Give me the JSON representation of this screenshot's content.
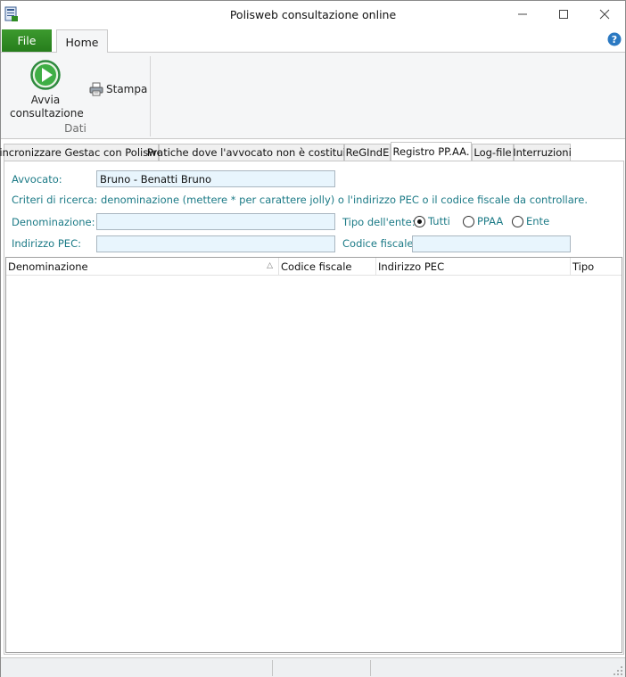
{
  "window": {
    "title": "Polisweb consultazione online"
  },
  "ribbon": {
    "tabs": [
      "File",
      "Home"
    ],
    "active_tab": "Home",
    "buttons": {
      "avvia_line1": "Avvia",
      "avvia_line2": "consultazione",
      "stampa": "Stampa"
    },
    "group_label": "Dati"
  },
  "content_tabs": [
    "Sincronizzare Gestac con Polisweb",
    "Pratiche dove l'avvocato non è costituito",
    "ReGIndE",
    "Registro PP.AA.",
    "Log-file",
    "Interruzioni"
  ],
  "active_content_tab": "Registro PP.AA.",
  "form": {
    "avvocato_label": "Avvocato:",
    "avvocato_value": "Bruno - Benatti Bruno",
    "criteria_text": "Criteri di ricerca: denominazione (mettere * per carattere jolly) o l'indirizzo PEC o il codice fiscale da controllare.",
    "denominazione_label": "Denominazione:",
    "denominazione_value": "",
    "tipo_ente_label": "Tipo dell'ente:",
    "tipo_ente_options": [
      "Tutti",
      "PPAA",
      "Ente"
    ],
    "tipo_ente_selected": "Tutti",
    "pec_label": "Indirizzo PEC:",
    "pec_value": "",
    "codice_fiscale_label": "Codice fiscale:",
    "codice_fiscale_value": ""
  },
  "grid": {
    "columns": [
      "Denominazione",
      "Codice fiscale",
      "Indirizzo PEC",
      "Tipo"
    ],
    "sorted_column": "Denominazione",
    "rows": []
  },
  "colors": {
    "file_tab": "#2f8c24",
    "label_teal": "#1b7a86",
    "field_bg": "#e8f5fd"
  }
}
